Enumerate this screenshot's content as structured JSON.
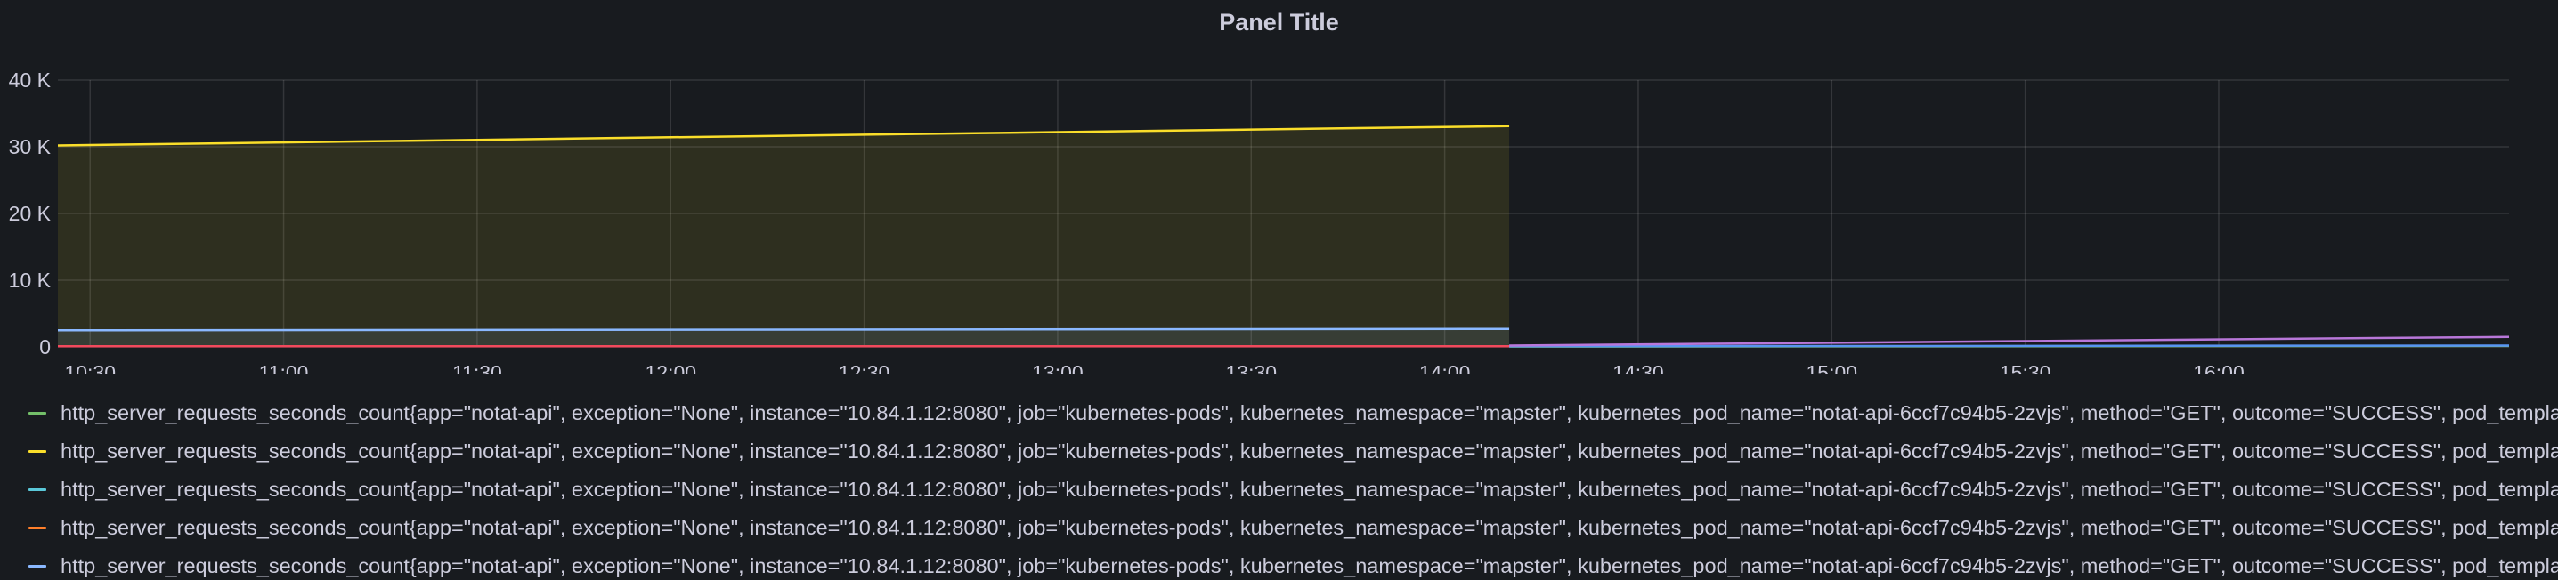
{
  "panel": {
    "title": "Panel Title"
  },
  "chart_data": {
    "type": "line",
    "title": "Panel Title",
    "x_type": "time",
    "xlim": [
      "10:25",
      "16:45"
    ],
    "ylim": [
      0,
      40000
    ],
    "grid": true,
    "legend_position": "bottom",
    "x_ticks": [
      "10:30",
      "11:00",
      "11:30",
      "12:00",
      "12:30",
      "13:00",
      "13:30",
      "14:00",
      "14:30",
      "15:00",
      "15:30",
      "16:00"
    ],
    "y_ticks": [
      {
        "value": 0,
        "label": "0"
      },
      {
        "value": 10000,
        "label": "10 K"
      },
      {
        "value": 20000,
        "label": "20 K"
      },
      {
        "value": 30000,
        "label": "30 K"
      },
      {
        "value": 40000,
        "label": "40 K"
      }
    ],
    "series": [
      {
        "color": "#fade2a",
        "fill": true,
        "points": [
          [
            "10:25",
            30200
          ],
          [
            "14:10",
            33100
          ]
        ]
      },
      {
        "color": "#8ab8ff",
        "fill": true,
        "points": [
          [
            "10:25",
            2500
          ],
          [
            "14:10",
            2700
          ]
        ]
      },
      {
        "color": "#f2495c",
        "fill": true,
        "points": [
          [
            "10:25",
            100
          ],
          [
            "14:10",
            100
          ]
        ]
      },
      {
        "color": "#73bf69",
        "fill": false,
        "points": [
          [
            "14:10",
            50
          ],
          [
            "16:45",
            150
          ]
        ]
      },
      {
        "color": "#5794f2",
        "fill": false,
        "points": [
          [
            "14:10",
            100
          ],
          [
            "16:45",
            200
          ]
        ]
      },
      {
        "color": "#b877d9",
        "fill": false,
        "points": [
          [
            "14:10",
            200
          ],
          [
            "16:45",
            1500
          ]
        ]
      }
    ]
  },
  "legend": {
    "items": [
      {
        "color": "#73bf69",
        "label": "http_server_requests_seconds_count{app=\"notat-api\", exception=\"None\", instance=\"10.84.1.12:8080\", job=\"kubernetes-pods\", kubernetes_namespace=\"mapster\", kubernetes_pod_name=\"notat-api-6ccf7c94b5-2zvjs\", method=\"GET\", outcome=\"SUCCESS\", pod_template_hash"
      },
      {
        "color": "#fade2a",
        "label": "http_server_requests_seconds_count{app=\"notat-api\", exception=\"None\", instance=\"10.84.1.12:8080\", job=\"kubernetes-pods\", kubernetes_namespace=\"mapster\", kubernetes_pod_name=\"notat-api-6ccf7c94b5-2zvjs\", method=\"GET\", outcome=\"SUCCESS\", pod_template_hash"
      },
      {
        "color": "#5ac8d9",
        "label": "http_server_requests_seconds_count{app=\"notat-api\", exception=\"None\", instance=\"10.84.1.12:8080\", job=\"kubernetes-pods\", kubernetes_namespace=\"mapster\", kubernetes_pod_name=\"notat-api-6ccf7c94b5-2zvjs\", method=\"GET\", outcome=\"SUCCESS\", pod_template_hash"
      },
      {
        "color": "#ff7f2a",
        "label": "http_server_requests_seconds_count{app=\"notat-api\", exception=\"None\", instance=\"10.84.1.12:8080\", job=\"kubernetes-pods\", kubernetes_namespace=\"mapster\", kubernetes_pod_name=\"notat-api-6ccf7c94b5-2zvjs\", method=\"GET\", outcome=\"SUCCESS\", pod_template_hash"
      },
      {
        "color": "#8ab8ff",
        "label": "http_server_requests_seconds_count{app=\"notat-api\", exception=\"None\", instance=\"10.84.1.12:8080\", job=\"kubernetes-pods\", kubernetes_namespace=\"mapster\", kubernetes_pod_name=\"notat-api-6ccf7c94b5-2zvjs\", method=\"GET\", outcome=\"SUCCESS\", pod_template_hash"
      }
    ]
  }
}
